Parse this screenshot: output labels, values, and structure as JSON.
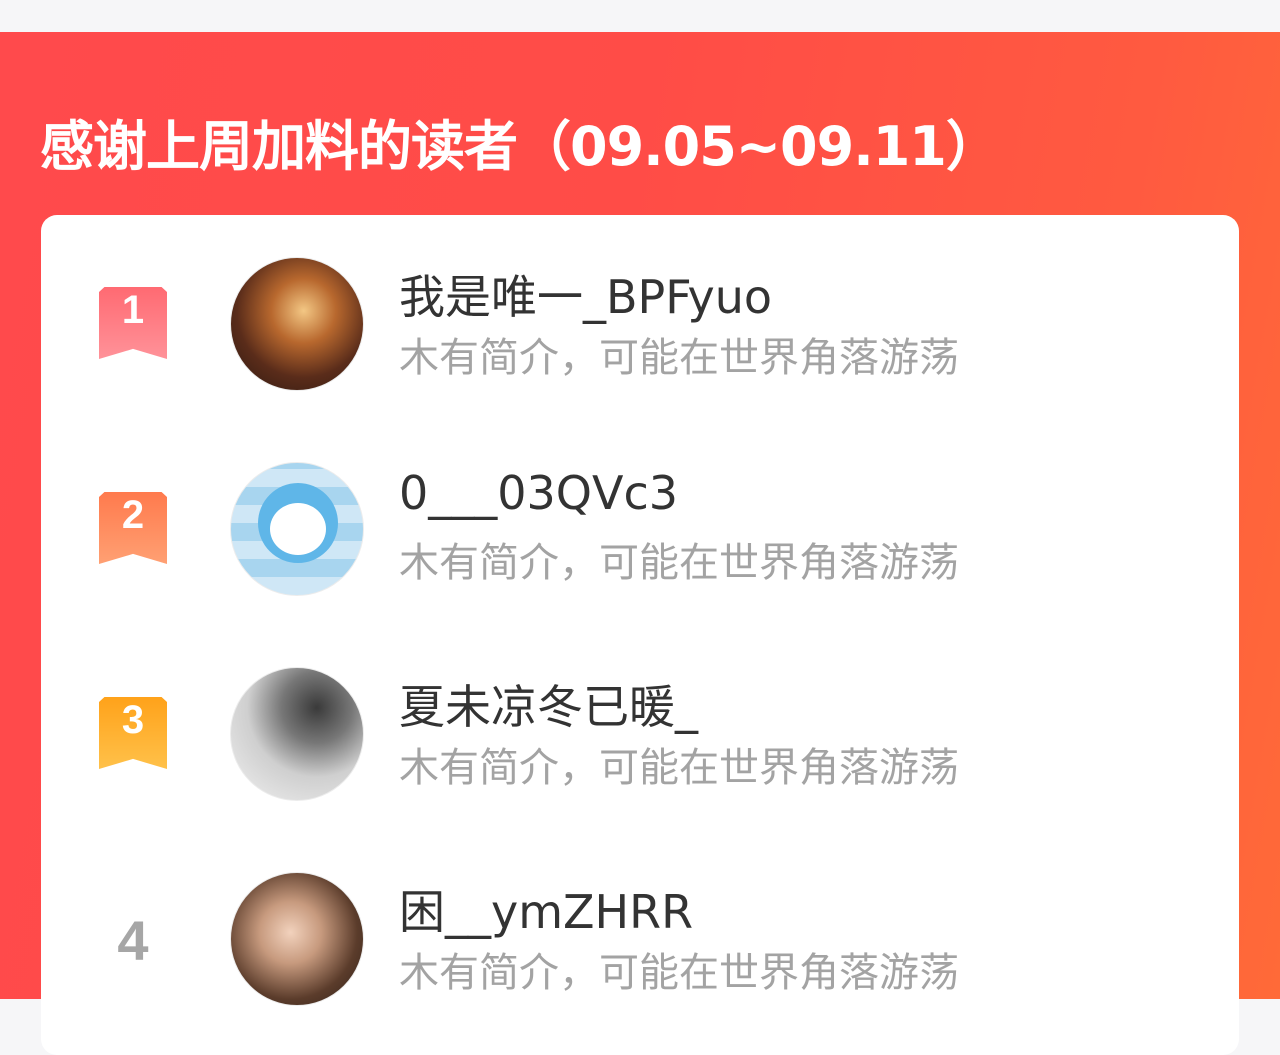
{
  "header": {
    "title": "感谢上周加料的读者（09.05~09.11）"
  },
  "readers": [
    {
      "rank": "1",
      "name": "我是唯一_BPFyuo",
      "bio": "木有简介，可能在世界角落游荡"
    },
    {
      "rank": "2",
      "name": "0___03QVc3",
      "bio": "木有简介，可能在世界角落游荡"
    },
    {
      "rank": "3",
      "name": "夏未凉冬已暖_",
      "bio": "木有简介，可能在世界角落游荡"
    },
    {
      "rank": "4",
      "name": "困__ymZHRR",
      "bio": "木有简介，可能在世界角落游荡"
    }
  ],
  "colors": {
    "banner": "#ff4a4c",
    "rank1": "#ff6a72",
    "rank2": "#ff7a4d",
    "rank3": "#ffa21a",
    "rank_plain": "#a6a6a6"
  }
}
